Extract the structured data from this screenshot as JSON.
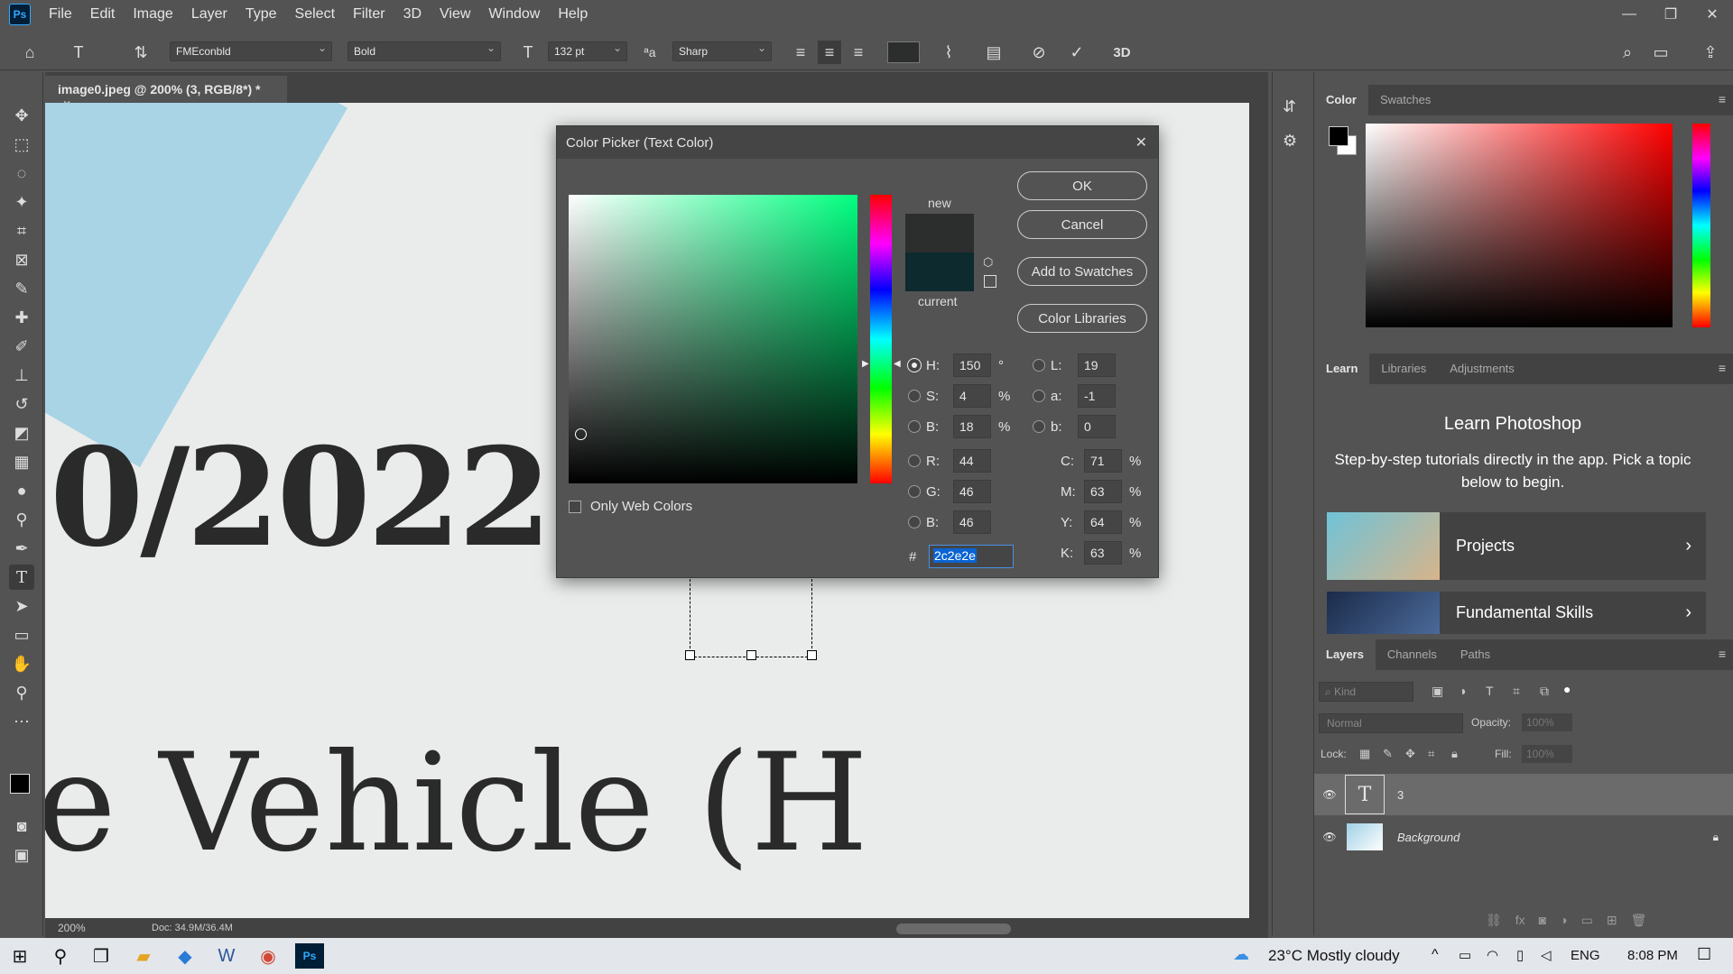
{
  "app": {
    "logo": "Ps"
  },
  "menu": [
    "File",
    "Edit",
    "Image",
    "Layer",
    "Type",
    "Select",
    "Filter",
    "3D",
    "View",
    "Window",
    "Help"
  ],
  "window_controls": {
    "minimize": "—",
    "restore": "❐",
    "close": "✕"
  },
  "options": {
    "font_family": "FMEconbld",
    "font_style": "Bold",
    "font_size": "132 pt",
    "aa_label": "ªa",
    "antialias": "Sharp",
    "mode_3d": "3D"
  },
  "document": {
    "tab_title": "image0.jpeg @ 200% (3, RGB/8*) *",
    "tab_close": "×",
    "canvas_text_1": "0/2022",
    "canvas_text_2": "e Vehicle (H",
    "zoom": "200%",
    "doc_info": "Doc: 34.9M/36.4M"
  },
  "color_picker": {
    "title": "Color Picker (Text Color)",
    "close": "✕",
    "label_new": "new",
    "label_current": "current",
    "new_color": "#2c2e2e",
    "current_color": "#0d2a2e",
    "buttons": {
      "ok": "OK",
      "cancel": "Cancel",
      "add_swatches": "Add to Swatches",
      "libraries": "Color Libraries"
    },
    "only_web_colors": "Only Web Colors",
    "fields": {
      "H": {
        "label": "H:",
        "value": "150",
        "unit": "°"
      },
      "S": {
        "label": "S:",
        "value": "4",
        "unit": "%"
      },
      "Bv": {
        "label": "B:",
        "value": "18",
        "unit": "%"
      },
      "R": {
        "label": "R:",
        "value": "44"
      },
      "G": {
        "label": "G:",
        "value": "46"
      },
      "Bc": {
        "label": "B:",
        "value": "46"
      },
      "L": {
        "label": "L:",
        "value": "19"
      },
      "a": {
        "label": "a:",
        "value": "-1"
      },
      "b": {
        "label": "b:",
        "value": "0"
      },
      "C": {
        "label": "C:",
        "value": "71",
        "unit": "%"
      },
      "M": {
        "label": "M:",
        "value": "63",
        "unit": "%"
      },
      "Y": {
        "label": "Y:",
        "value": "64",
        "unit": "%"
      },
      "K": {
        "label": "K:",
        "value": "63",
        "unit": "%"
      },
      "hash": "#",
      "hex": "2c2e2e"
    }
  },
  "panels": {
    "color_tabs": [
      "Color",
      "Swatches"
    ],
    "learn_tabs": [
      "Learn",
      "Libraries",
      "Adjustments"
    ],
    "learn_title": "Learn Photoshop",
    "learn_desc": "Step-by-step tutorials directly in the app. Pick a topic below to begin.",
    "learn_cards": [
      "Projects",
      "Fundamental Skills"
    ],
    "layers_tabs": [
      "Layers",
      "Channels",
      "Paths"
    ],
    "kind_placeholder": "Kind",
    "blend_mode": "Normal",
    "opacity_label": "Opacity:",
    "opacity_value": "100%",
    "lock_label": "Lock:",
    "fill_label": "Fill:",
    "fill_value": "100%",
    "layers": [
      {
        "name": "3",
        "type": "text"
      },
      {
        "name": "Background",
        "type": "image"
      }
    ],
    "fg_color": "#000000",
    "bg_color": "#ffffff"
  },
  "taskbar": {
    "weather": "23°C  Mostly cloudy",
    "lang": "ENG",
    "time": "8:08 PM"
  },
  "colors": {
    "accent": "#31a8ff",
    "hex_select": "#0a64d2"
  }
}
